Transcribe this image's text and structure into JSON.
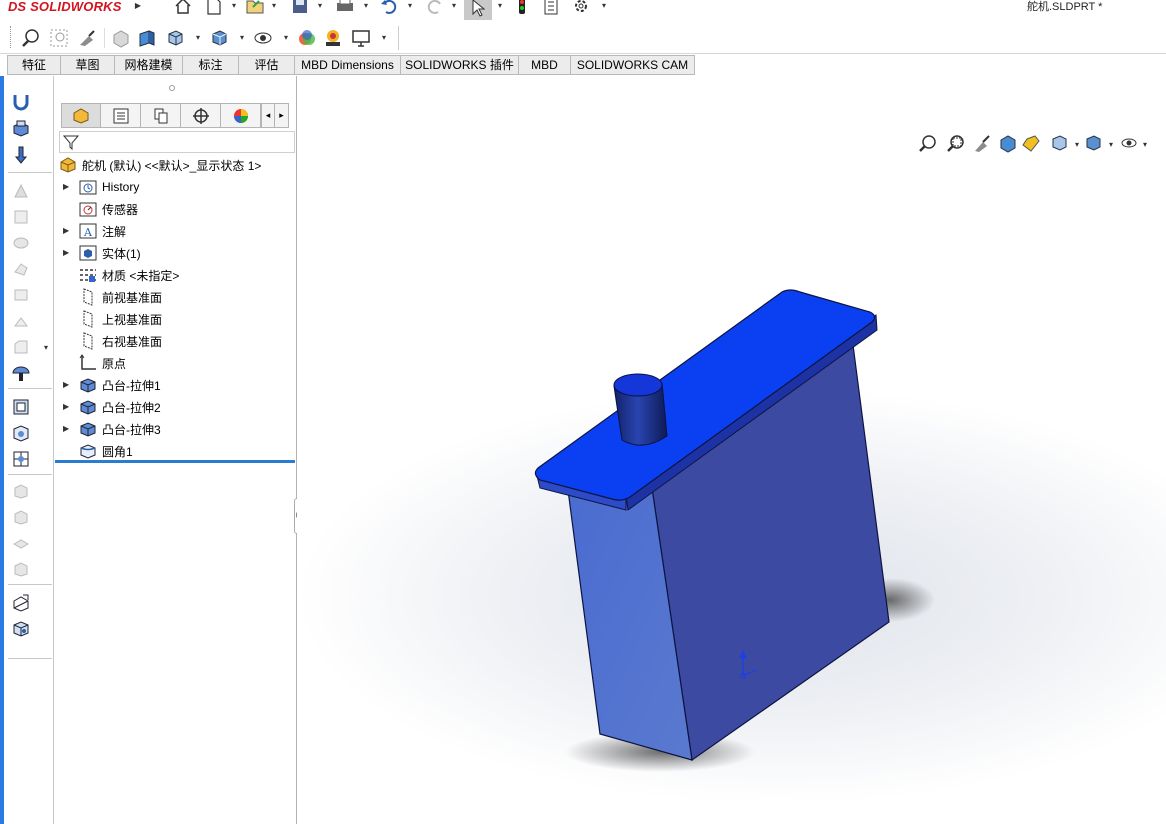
{
  "app": {
    "logo_ds": "DS",
    "logo_name": "SOLIDWORKS",
    "document_title": "舵机.SLDPRT *"
  },
  "command_tabs": [
    {
      "label": "特征"
    },
    {
      "label": "草图"
    },
    {
      "label": "网格建模"
    },
    {
      "label": "标注"
    },
    {
      "label": "评估"
    },
    {
      "label": "MBD Dimensions"
    },
    {
      "label": "SOLIDWORKS 插件"
    },
    {
      "label": "MBD"
    },
    {
      "label": "SOLIDWORKS CAM"
    }
  ],
  "feature_tree": {
    "root": "舵机 (默认) <<默认>_显示状态 1>",
    "items": [
      {
        "label": "History",
        "icon": "history-icon",
        "expandable": true
      },
      {
        "label": "传感器",
        "icon": "sensor-icon",
        "expandable": false
      },
      {
        "label": "注解",
        "icon": "annotation-icon",
        "expandable": true
      },
      {
        "label": "实体(1)",
        "icon": "solid-bodies-icon",
        "expandable": true
      },
      {
        "label": "材质 <未指定>",
        "icon": "material-icon",
        "expandable": false
      },
      {
        "label": "前视基准面",
        "icon": "plane-icon",
        "expandable": false
      },
      {
        "label": "上视基准面",
        "icon": "plane-icon",
        "expandable": false
      },
      {
        "label": "右视基准面",
        "icon": "plane-icon",
        "expandable": false
      },
      {
        "label": "原点",
        "icon": "origin-icon",
        "expandable": false
      },
      {
        "label": "凸台-拉伸1",
        "icon": "extrude-icon",
        "expandable": true
      },
      {
        "label": "凸台-拉伸2",
        "icon": "extrude-icon",
        "expandable": true
      },
      {
        "label": "凸台-拉伸3",
        "icon": "extrude-icon",
        "expandable": true
      },
      {
        "label": "圆角1",
        "icon": "fillet-icon",
        "expandable": false
      }
    ]
  },
  "colors": {
    "accent_blue": "#2a7be4",
    "model_top": "#0b3ff2",
    "model_front": "#5070cc",
    "model_side": "#3c4aa0"
  }
}
